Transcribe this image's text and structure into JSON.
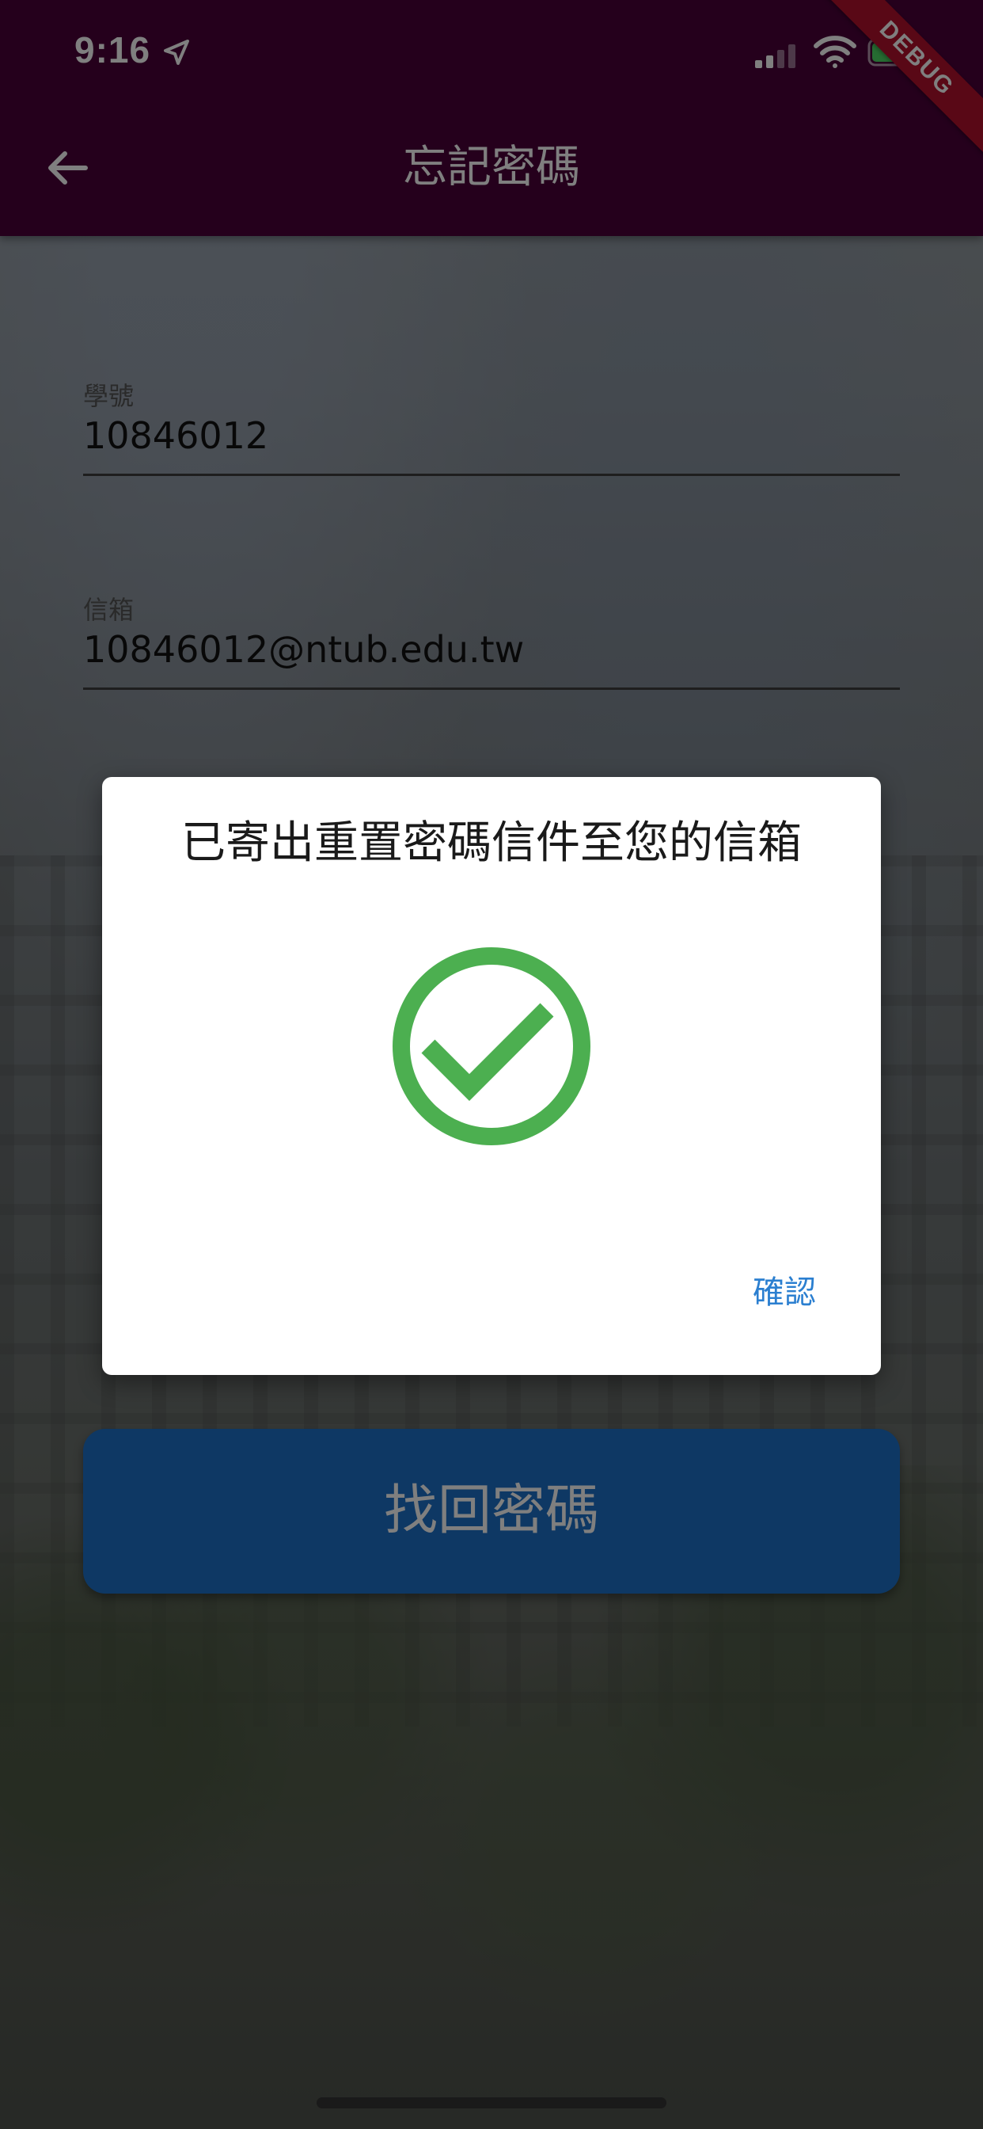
{
  "status_bar": {
    "time": "9:16",
    "location_icon": "location-arrow-icon",
    "signal_icon": "cellular-signal-icon",
    "wifi_icon": "wifi-icon",
    "battery_icon": "battery-charging-icon"
  },
  "debug_banner": "DEBUG",
  "app_bar": {
    "back_icon": "arrow-left-icon",
    "title": "忘記密碼"
  },
  "form": {
    "student_id": {
      "label": "學號",
      "value": "10846012"
    },
    "email": {
      "label": "信箱",
      "value": "10846012@ntub.edu.tw"
    },
    "submit_label": "找回密碼"
  },
  "dialog": {
    "title": "已寄出重置密碼信件至您的信箱",
    "icon": "check-circle-icon",
    "confirm_label": "確認"
  },
  "colors": {
    "app_bar": "#4a0039",
    "button": "#1d71c9",
    "success": "#4caf50",
    "link": "#2b7fd0",
    "debug": "#b3102c"
  }
}
